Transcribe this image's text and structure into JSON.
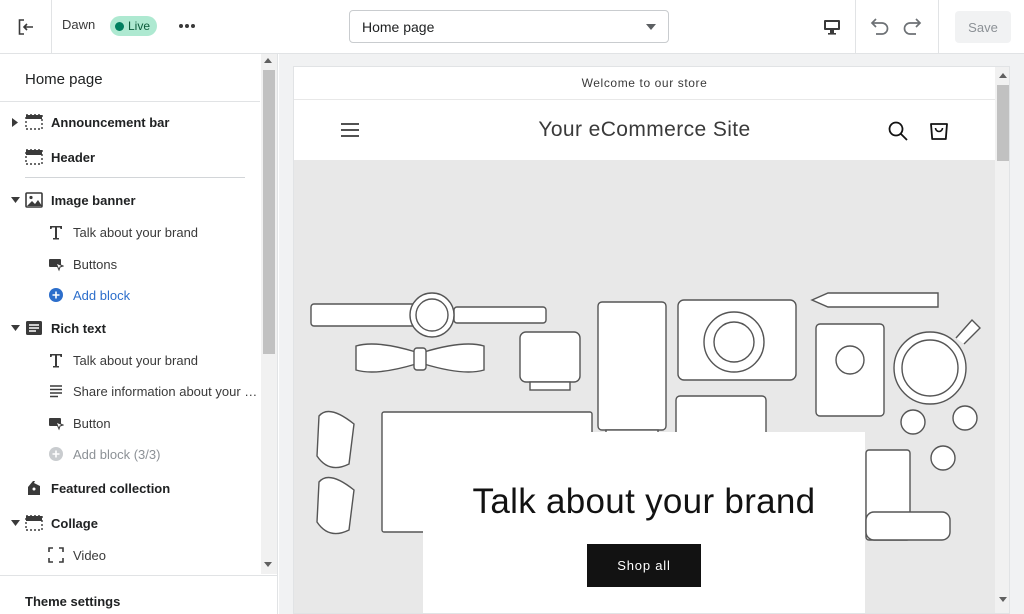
{
  "topbar": {
    "theme_name": "Dawn",
    "live_label": "Live",
    "page_select_value": "Home page",
    "save_label": "Save"
  },
  "sidebar": {
    "title": "Home page",
    "items": [
      {
        "label": "Announcement bar",
        "icon": "announcement-bar-icon"
      },
      {
        "label": "Header",
        "icon": "header-icon"
      },
      {
        "label": "Image banner",
        "icon": "image-icon"
      },
      {
        "label": "Talk about your brand",
        "icon": "text-icon"
      },
      {
        "label": "Buttons",
        "icon": "button-icon"
      },
      {
        "label": "Add block",
        "icon": "add-circle-icon"
      },
      {
        "label": "Rich text",
        "icon": "rich-text-icon"
      },
      {
        "label": "Talk about your brand",
        "icon": "text-icon"
      },
      {
        "label": "Share information about your brand",
        "icon": "paragraph-icon"
      },
      {
        "label": "Button",
        "icon": "button-icon"
      },
      {
        "label": "Add block (3/3)",
        "icon": "add-circle-icon"
      },
      {
        "label": "Featured collection",
        "icon": "tag-icon"
      },
      {
        "label": "Collage",
        "icon": "collage-icon"
      },
      {
        "label": "Video",
        "icon": "video-icon"
      }
    ],
    "footer_label": "Theme settings"
  },
  "preview": {
    "announcement": "Welcome to our store",
    "site_title": "Your eCommerce Site",
    "banner_heading": "Talk about your brand",
    "banner_button": "Shop all"
  },
  "colors": {
    "accent_link": "#2c6ecb",
    "live_badge_bg": "#aee9d1",
    "banner_bg": "#e8e8e8",
    "button_bg": "#121212"
  }
}
